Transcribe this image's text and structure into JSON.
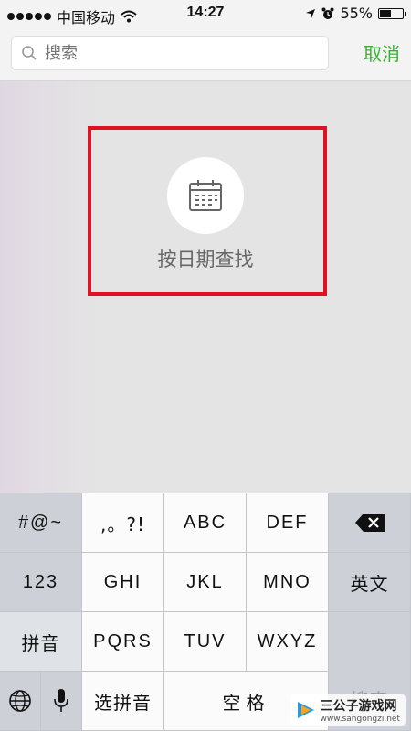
{
  "status_bar": {
    "carrier": "中国移动",
    "time": "14:27",
    "battery": "55%",
    "battery_level": 0.55
  },
  "search": {
    "placeholder": "搜索",
    "cancel_label": "取消"
  },
  "content": {
    "option_label": "按日期查找"
  },
  "keyboard": {
    "row1": [
      "#@~",
      ",。?!",
      "ABC",
      "DEF"
    ],
    "row2": [
      "123",
      "GHI",
      "JKL",
      "MNO",
      "英文"
    ],
    "row3": [
      "拼音",
      "PQRS",
      "TUV",
      "WXYZ"
    ],
    "search_key": "搜索",
    "select_pinyin": "选拼音",
    "space": "空格"
  },
  "watermark": {
    "brand": "三公子游戏网",
    "url": "www.sangongzi.net"
  },
  "colors": {
    "accent_green": "#3cb034",
    "highlight_red": "#e0121f"
  }
}
